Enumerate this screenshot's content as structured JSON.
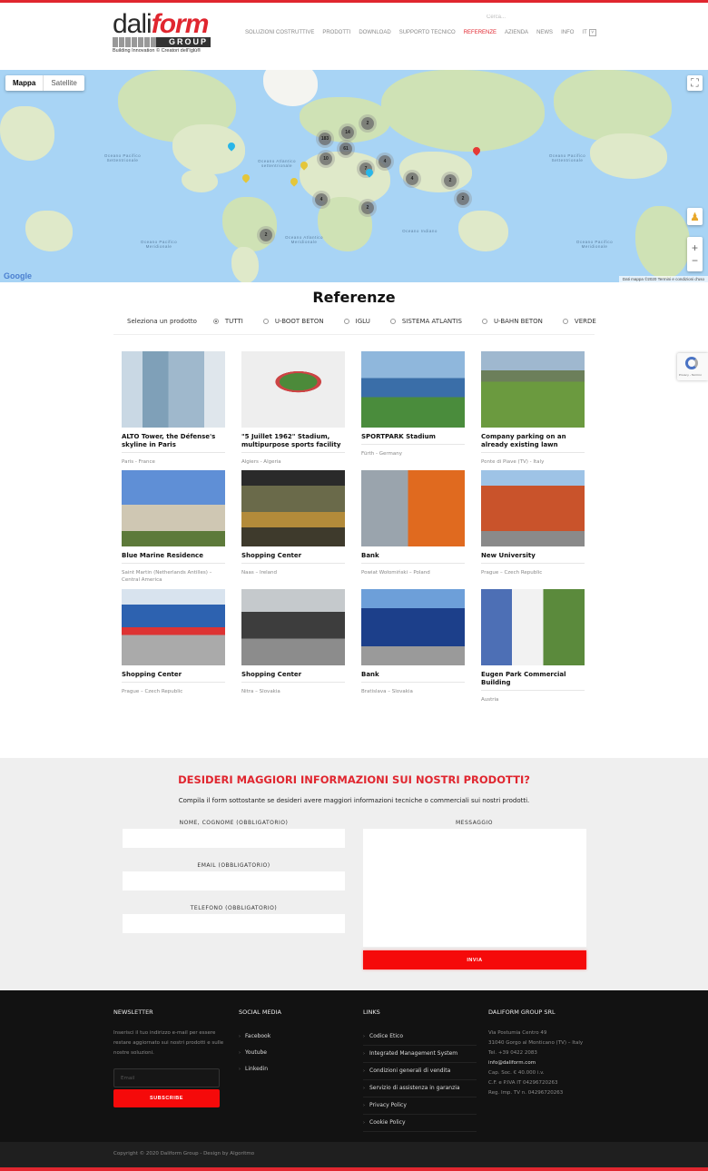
{
  "header": {
    "logo": {
      "word_a": "dali",
      "word_b": "form",
      "group": "GROUP",
      "tagline": "Building Innovation © Creatori dell'Iglù®"
    },
    "search_placeholder": "Cerca...",
    "nav": [
      {
        "label": "SOLUZIONI COSTRUTTIVE",
        "active": false
      },
      {
        "label": "PRODOTTI",
        "active": false
      },
      {
        "label": "DOWNLOAD",
        "active": false
      },
      {
        "label": "SUPPORTO TECNICO",
        "active": false
      },
      {
        "label": "REFERENZE",
        "active": true
      },
      {
        "label": "AZIENDA",
        "active": false
      },
      {
        "label": "NEWS",
        "active": false
      },
      {
        "label": "INFO",
        "active": false
      }
    ],
    "language": "IT"
  },
  "map": {
    "type_buttons": [
      "Mappa",
      "Satellite"
    ],
    "selected_type": "Mappa",
    "clusters": [
      "183",
      "14",
      "2",
      "61",
      "10",
      "7",
      "4",
      "4",
      "2",
      "2",
      "2",
      "4",
      "2"
    ],
    "labels": {
      "pacific_n": "Oceano Pacifico Settentrionale",
      "atlantic_n": "Oceano Atlantico settentrionale",
      "pacific_s": "Oceano Pacifico Meridionale",
      "atlantic_s": "Oceano Atlantico Meridionale",
      "indian": "Oceano Indiano"
    },
    "google": "Google",
    "attribution": "Dati mappa ©2020   Termini e condizioni d'uso",
    "zoom_in": "+",
    "zoom_out": "−"
  },
  "references": {
    "title": "Referenze",
    "filter_label": "Seleziona un prodotto",
    "filters": [
      {
        "label": "TUTTI",
        "selected": true
      },
      {
        "label": "U-BOOT BETON",
        "selected": false
      },
      {
        "label": "IGLU",
        "selected": false
      },
      {
        "label": "SISTEMA ATLANTIS",
        "selected": false
      },
      {
        "label": "U-BAHN BETON",
        "selected": false
      },
      {
        "label": "VERDE",
        "selected": false
      }
    ],
    "items": [
      {
        "title": "ALTO Tower, the Défense's skyline in Paris",
        "location": "Paris - France"
      },
      {
        "title": "\"5 Juillet 1962\" Stadium, multipurpose sports facility",
        "location": "Algiers - Algeria"
      },
      {
        "title": "SPORTPARK Stadium",
        "location": "Fürth - Germany"
      },
      {
        "title": "Company parking on an already existing lawn",
        "location": "Ponte di Piave (TV) - Italy"
      },
      {
        "title": "Blue Marine Residence",
        "location": "Saint Martin (Netherlands Antilles) – Central America"
      },
      {
        "title": "Shopping Center",
        "location": "Naas – Ireland"
      },
      {
        "title": "Bank",
        "location": "Powiat Wołomiński – Poland"
      },
      {
        "title": "New University",
        "location": "Prague – Czech Republic"
      },
      {
        "title": "Shopping Center",
        "location": "Prague – Czech Republic"
      },
      {
        "title": "Shopping Center",
        "location": "Nitra – Slovakia"
      },
      {
        "title": "Bank",
        "location": "Bratislava – Slovakia"
      },
      {
        "title": "Eugen Park Commercial Building",
        "location": "Austria"
      }
    ]
  },
  "recaptcha": {
    "text": "Privacy - Termini"
  },
  "contact": {
    "title": "DESIDERI MAGGIORI INFORMAZIONI SUI NOSTRI PRODOTTI?",
    "subtitle": "Compila il form sottostante se desideri avere maggiori informazioni tecniche o commerciali sui nostri prodotti.",
    "name_label": "NOME, COGNOME (OBBLIGATORIO)",
    "email_label": "EMAIL (OBBLIGATORIO)",
    "phone_label": "TELEFONO (OBBLIGATORIO)",
    "message_label": "MESSAGGIO",
    "submit": "INVIA"
  },
  "footer": {
    "newsletter": {
      "title": "NEWSLETTER",
      "text": "Inserisci il tuo indirizzo e-mail per essere restare aggiornato sui nostri prodotti e sulle nostre soluzioni.",
      "email_placeholder": "Email",
      "button": "SUBSCRIBE"
    },
    "social": {
      "title": "SOCIAL MEDIA",
      "items": [
        "Facebook",
        "Youtube",
        "Linkedin"
      ]
    },
    "links": {
      "title": "LINKS",
      "items": [
        "Codice Etico",
        "Integrated Management System",
        "Condizioni generali di vendita",
        "Servizio di assistenza in garanzia",
        "Privacy Policy",
        "Cookie Policy"
      ]
    },
    "company": {
      "title": "DALIFORM GROUP SRL",
      "address1": "Via Postumia Centro 49",
      "address2": "31040 Gorgo al Monticano (TV) – Italy",
      "phone": "Tel. +39 0422 2083",
      "email": "info@daliform.com",
      "capital": "Cap. Soc. € 40.000 i.v.",
      "vat": "C.F. e P.IVA IT 04296720263",
      "reg": "Reg. Imp. TV n. 04296720263"
    },
    "copyright": "Copyright © 2020 Daliform Group - Design by Algoritmo"
  }
}
